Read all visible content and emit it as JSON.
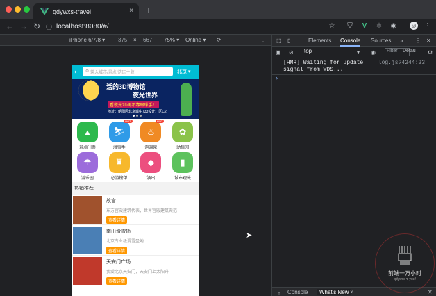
{
  "browser": {
    "tab_title": "qdywxs-travel",
    "tab_close": "×",
    "new_tab": "+",
    "url": "localhost:8080/#/",
    "extensions": [
      "star-icon",
      "shield-icon",
      "vue-icon",
      "react-icon",
      "record-icon",
      "avatar",
      "menu-icon"
    ]
  },
  "device_toolbar": {
    "device": "iPhone 6/7/8 ▾",
    "width": "375",
    "times": "×",
    "height": "667",
    "zoom": "75% ▾",
    "network": "Online ▾"
  },
  "app": {
    "back": "‹",
    "search_placeholder": "输入城市/景点/游玩主题",
    "city": "北京 ▾",
    "banner": {
      "line1": "活的3D博物馆",
      "line2": "夜光世界",
      "line3": "看夜光7D再不靠眼球手！",
      "line4": "地址：朝阳区北京城中733设计厂区C2"
    },
    "icons": [
      {
        "label": "景点门票",
        "color": "#2db94d",
        "glyph": "▲",
        "hot": ""
      },
      {
        "label": "滑雪季",
        "color": "#2f9be8",
        "glyph": "⛷",
        "hot": "HOT"
      },
      {
        "label": "泡温泉",
        "color": "#f08a24",
        "glyph": "♨",
        "hot": "HOT"
      },
      {
        "label": "动植园",
        "color": "#8bc34a",
        "glyph": "✿",
        "hot": ""
      },
      {
        "label": "游乐园",
        "color": "#9c6cdb",
        "glyph": "☂",
        "hot": ""
      },
      {
        "label": "必游榜单",
        "color": "#f7b82c",
        "glyph": "♜",
        "hot": ""
      },
      {
        "label": "演出",
        "color": "#ec4f7f",
        "glyph": "◆",
        "hot": ""
      },
      {
        "label": "城市观光",
        "color": "#5dc25d",
        "glyph": "▮",
        "hot": ""
      }
    ],
    "section_title": "热销推荐",
    "items": [
      {
        "name": "故宫",
        "desc": "东方宫殿建筑代表，世界宫殿建筑典范",
        "btn": "查看详情",
        "thumb": "#a0522d"
      },
      {
        "name": "南山滑雪场",
        "desc": "北京专业级滑雪圣地",
        "btn": "查看详情",
        "thumb": "#4a7fb5"
      },
      {
        "name": "天安门广场",
        "desc": "我爱北京天安门，天安门上太阳升",
        "btn": "查看详情",
        "thumb": "#c0392b"
      }
    ]
  },
  "devtools": {
    "tabs": [
      "Elements",
      "Console",
      "Sources",
      "»"
    ],
    "active_tab": "Console",
    "context": "top",
    "filter_placeholder": "Filter",
    "levels": "Defau",
    "log_message_1": "[HMR] Waiting for update",
    "log_message_2": "signal from WDS...",
    "log_source": "log.js?4244:23",
    "prompt": "›",
    "drawer_tabs": [
      "Console",
      "What's New"
    ],
    "drawer_close": "×"
  },
  "watermark": {
    "title": "前端一万小时",
    "sub": "qdywxs ♥ you!"
  }
}
